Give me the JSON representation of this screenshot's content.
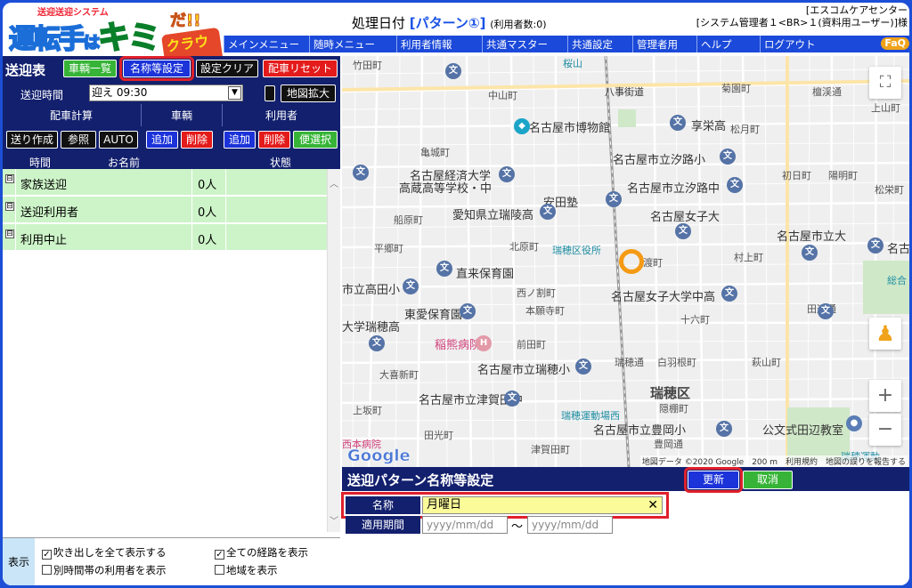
{
  "header": {
    "logo": {
      "sub": "送迎送迎システム",
      "main_a": "運転手",
      "main_b": "は",
      "main_c": "キミ",
      "main_d": "だ!!",
      "main_e": "クラウド"
    },
    "title_prefix": "処理日付",
    "pattern": "[パターン①]",
    "user_count": "(利用者数:0)",
    "user_line1": "[エスコムケアセンター",
    "user_line2": "[システム管理者１<BR>１(資料用ユーザー)]様",
    "faq": "FaQ",
    "menu": [
      "メインメニュー",
      "随時メニュー",
      "利用者情報",
      "共通マスター",
      "共通設定",
      "管理者用",
      "ヘルプ",
      "ログアウト"
    ]
  },
  "left": {
    "title": "送迎表",
    "btn_vehicle_list": "車輌一覧",
    "btn_name_settings": "名称等設定",
    "btn_clear_settings": "設定クリア",
    "btn_reset_allocation": "配車リセット",
    "time_label": "送迎時間",
    "time_value": "迎え 09:30",
    "btn_map_expand": "地図拡大",
    "group_calc": "配車計算",
    "group_vehicle": "車輌",
    "group_user": "利用者",
    "btn_send_create": "送り作成",
    "btn_view": "参照",
    "btn_auto": "AUTO",
    "btn_vehicle_add": "追加",
    "btn_vehicle_del": "削除",
    "btn_user_add": "追加",
    "btn_user_del": "削除",
    "btn_convenience": "便選択",
    "col_time": "時間",
    "col_name": "お名前",
    "col_status": "状態",
    "rows": [
      {
        "toggle": "⊟",
        "name": "家族送迎",
        "count": "0人"
      },
      {
        "toggle": "⊟",
        "name": "送迎利用者",
        "count": "0人"
      },
      {
        "toggle": "⊟",
        "name": "利用中止",
        "count": "0人"
      }
    ],
    "display_label": "表示",
    "opt_show_bubbles": "吹き出しを全て表示する",
    "opt_show_routes": "全ての経路を表示",
    "opt_other_time": "別時間帯の利用者を表示",
    "opt_show_region": "地域を表示"
  },
  "map": {
    "labels": {
      "l1": "竹田町",
      "l2": "中山町",
      "l3": "八事街道",
      "l4": "菊園町",
      "l5": "檀渓通",
      "l6": "上山町",
      "l7": "名古屋市博物館",
      "l8": "享栄高",
      "l9": "松月町",
      "l10": "亀城町",
      "l11": "名古屋市立汐路小",
      "l12": "名古屋経済大学",
      "l13": "高蔵高等学校・中",
      "l14": "名古屋市立汐路中",
      "l15": "初日町",
      "l16": "陽明町",
      "l17": "松栄町",
      "l18": "安田塾",
      "l19": "愛知県立瑞陵高",
      "l20": "名古屋女子大",
      "l21": "船原町",
      "l22": "平郷町",
      "l23": "北原町",
      "l24": "瑞穂区役所",
      "l25": "村上町",
      "l26": "名古屋市立大",
      "l27": "直来保育園",
      "l28": "市立高田小",
      "l29": "西ノ割町",
      "l30": "名古屋女子大学中高",
      "l31": "本願寺町",
      "l32": "東愛保育園",
      "l33": "十六町",
      "l34": "田辺通",
      "l35": "大学瑞穂高",
      "l36": "稲熊病院",
      "l37": "前田町",
      "l38": "大喜新町",
      "l39": "名古屋市立瑞穂小",
      "l40": "瑞穂通",
      "l41": "白羽根町",
      "l42": "萩山町",
      "l43": "瑞穂区",
      "l44": "名古屋市立津賀田中",
      "l45": "上坂町",
      "l46": "瑞穂運動場西",
      "l47": "隠棚町",
      "l48": "名古屋市立豊岡小",
      "l49": "公文式田辺教室",
      "l50": "田光町",
      "l51": "西本病院",
      "l52": "豊岡通",
      "l53": "津賀田町",
      "l54": "瑞穂運動",
      "l55": "桜山",
      "l56": "名古",
      "l57": "総合",
      "l58": "渡町"
    },
    "google": "Google",
    "attribution": "地図データ ©2020 Google　200 m　利用規約　地図の誤りを報告する",
    "fullscreen_icon": "⛶",
    "zoom_in": "+",
    "zoom_out": "−"
  },
  "settings": {
    "title": "送迎パターン名称等設定",
    "btn_update": "更新",
    "btn_cancel": "取消",
    "name_label": "名称",
    "name_value": "月曜日",
    "clear_icon": "✕",
    "period_label": "適用期間",
    "date_from_placeholder": "yyyy/mm/dd",
    "date_to_placeholder": "yyyy/mm/dd",
    "tilde": "〜"
  }
}
